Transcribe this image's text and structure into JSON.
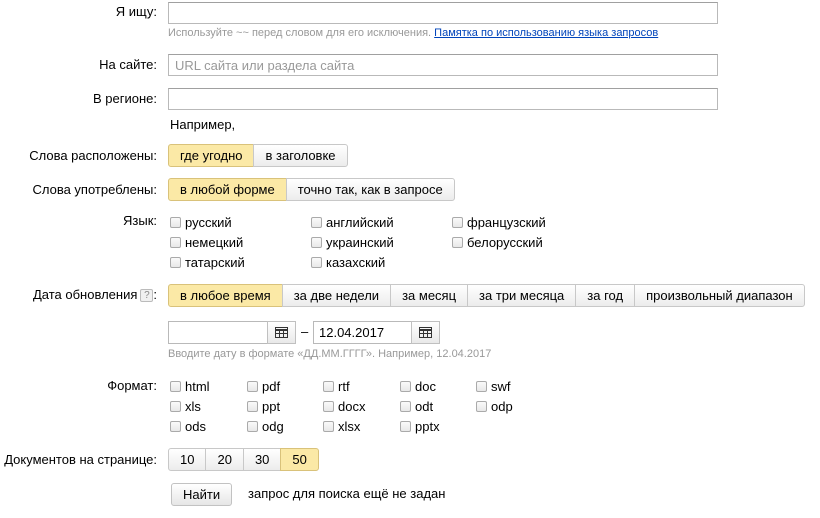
{
  "query": {
    "label": "Я ищу:",
    "value": "",
    "hint": "Используйте ~~ перед словом для его исключения.",
    "hint_link": "Памятка по использованию языка запросов"
  },
  "site": {
    "label": "На сайте:",
    "placeholder": "URL сайта или раздела сайта"
  },
  "region": {
    "label": "В регионе:",
    "value": "",
    "example": "Например,"
  },
  "words_position": {
    "label": "Слова расположены:",
    "options": [
      "где угодно",
      "в заголовке"
    ],
    "selected": "где угодно"
  },
  "words_form": {
    "label": "Слова употреблены:",
    "options": [
      "в любой форме",
      "точно так, как в запросе"
    ],
    "selected": "в любой форме"
  },
  "language": {
    "label": "Язык:",
    "options": [
      "русский",
      "английский",
      "французский",
      "немецкий",
      "украинский",
      "белорусский",
      "татарский",
      "казахский"
    ]
  },
  "update_date": {
    "label": "Дата обновления",
    "help": "?",
    "options": [
      "в любое время",
      "за две недели",
      "за месяц",
      "за три месяца",
      "за год",
      "произвольный диапазон"
    ],
    "selected": "в любое время",
    "date_from": "",
    "dash": "–",
    "date_to": "12.04.2017",
    "hint": "Вводите дату в формате «ДД.ММ.ГГГГ». Например, 12.04.2017"
  },
  "format": {
    "label": "Формат:",
    "options": [
      "html",
      "pdf",
      "rtf",
      "doc",
      "swf",
      "xls",
      "ppt",
      "docx",
      "odt",
      "odp",
      "ods",
      "odg",
      "xlsx",
      "pptx"
    ]
  },
  "per_page": {
    "label": "Документов на странице:",
    "options": [
      "10",
      "20",
      "30",
      "50"
    ],
    "selected": "50"
  },
  "submit": {
    "label": "Найти",
    "status": "запрос для поиска ещё не задан"
  },
  "icons": {
    "calendar": "calendar-icon",
    "help": "help-icon",
    "checkbox": "checkbox"
  },
  "colors": {
    "selected_bg": "#fbe9a6",
    "link": "#0044bb",
    "hint": "#999999"
  }
}
